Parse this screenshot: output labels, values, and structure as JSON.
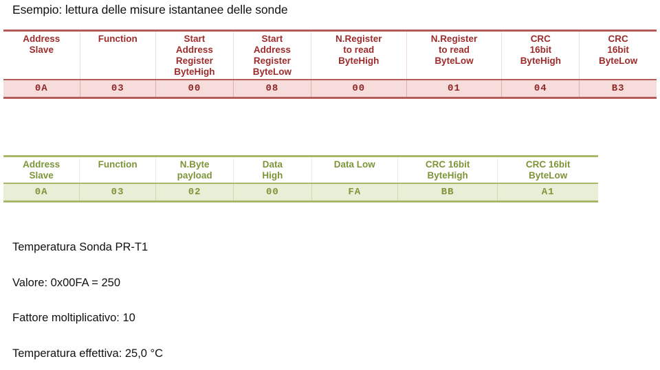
{
  "page": {
    "title": "Esempio: lettura delle misure istantanee delle sonde"
  },
  "theme": {
    "red_border": "#b55a5a",
    "red_text": "#9e2b2b",
    "red_band": "#f7dcdc",
    "green_border": "#a7b86a",
    "green_text": "#7d9438",
    "green_band": "#e9efd6",
    "body_text": "#111111"
  },
  "request_table": {
    "name": "modbus-request-frame",
    "accent": "#9e2b2b",
    "columns": [
      {
        "header": "Address\nSlave",
        "header_lines": [
          "Address",
          "Slave"
        ],
        "value": "0A",
        "width_pct": 11.7
      },
      {
        "header": "Function",
        "header_lines": [
          "Function"
        ],
        "value": "03",
        "width_pct": 11.6
      },
      {
        "header": "Start\nAddress\nRegister\nByteHigh",
        "header_lines": [
          "Start",
          "Address",
          "Register",
          "ByteHigh"
        ],
        "value": "00",
        "width_pct": 11.9
      },
      {
        "header": "Start\nAddress\nRegister\nByteLow",
        "header_lines": [
          "Start",
          "Address",
          "Register",
          "ByteLow"
        ],
        "value": "08",
        "width_pct": 11.9
      },
      {
        "header": "N.Register\nto read\nByteHigh",
        "header_lines": [
          "N.Register",
          "to read",
          "ByteHigh"
        ],
        "value": "00",
        "width_pct": 14.6
      },
      {
        "header": "N.Register\nto read\nByteLow",
        "header_lines": [
          "N.Register",
          "to read",
          "ByteLow"
        ],
        "value": "01",
        "width_pct": 14.6
      },
      {
        "header": "CRC\n16bit\nByteHigh",
        "header_lines": [
          "CRC",
          "16bit",
          "ByteHigh"
        ],
        "value": "04",
        "width_pct": 11.9
      },
      {
        "header": "CRC\n16bit\nByteLow",
        "header_lines": [
          "CRC",
          "16bit",
          "ByteLow"
        ],
        "value": "B3",
        "width_pct": 11.8
      }
    ]
  },
  "response_table": {
    "name": "modbus-response-frame",
    "accent": "#7d9438",
    "columns": [
      {
        "header": "Address\nSlave",
        "header_lines": [
          "Address",
          "Slave"
        ],
        "value": "0A",
        "width_pct": 12.8
      },
      {
        "header": "Function",
        "header_lines": [
          "Function"
        ],
        "value": "03",
        "width_pct": 12.8
      },
      {
        "header": "N.Byte\npayload",
        "header_lines": [
          "N.Byte",
          "payload"
        ],
        "value": "02",
        "width_pct": 13.1
      },
      {
        "header": "Data\nHigh",
        "header_lines": [
          "Data",
          "High"
        ],
        "value": "00",
        "width_pct": 13.1
      },
      {
        "header": "Data Low",
        "header_lines": [
          "Data Low"
        ],
        "value": "FA",
        "width_pct": 14.5
      },
      {
        "header": "CRC 16bit\nByteHigh",
        "header_lines": [
          "CRC 16bit",
          "ByteHigh"
        ],
        "value": "BB",
        "width_pct": 16.8
      },
      {
        "header": "CRC 16bit\nByteLow",
        "header_lines": [
          "CRC 16bit",
          "ByteLow"
        ],
        "value": "A1",
        "width_pct": 16.9
      }
    ]
  },
  "notes": {
    "lines": [
      "Temperatura Sonda PR-T1",
      "Valore: 0x00FA = 250",
      "Fattore moltiplicativo: 10",
      "Temperatura effettiva: 25,0 °C"
    ]
  }
}
